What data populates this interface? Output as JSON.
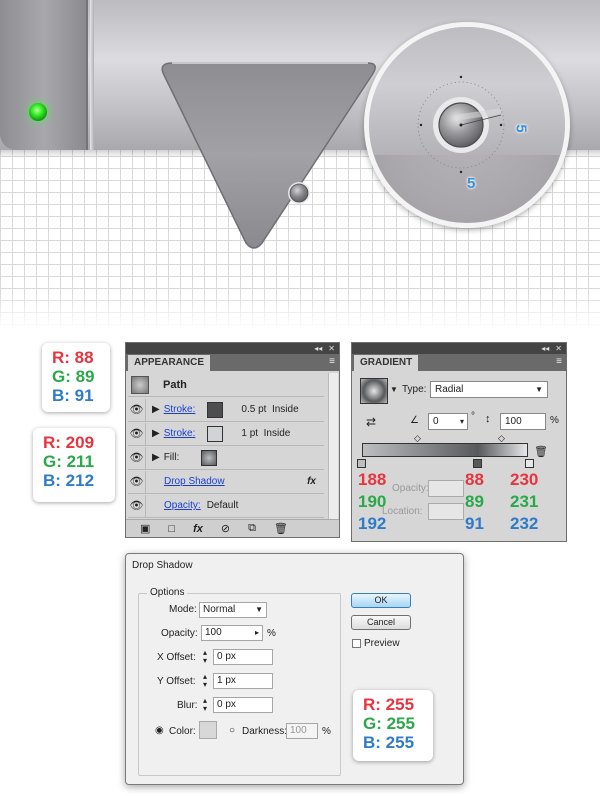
{
  "artwork": {
    "dim_right": "5",
    "dim_bottom": "5"
  },
  "swatches_left": [
    {
      "r": "R: 88",
      "g": "G: 89",
      "b": "B: 91"
    },
    {
      "r": "R: 209",
      "g": "G: 211",
      "b": "B: 212"
    }
  ],
  "appearance": {
    "tab": "APPEARANCE",
    "path_label": "Path",
    "rows": [
      {
        "label": "Stroke:",
        "value": "0.5 pt  Inside",
        "swatch_color": "#4e4e50"
      },
      {
        "label": "Stroke:",
        "value": "1 pt  Inside",
        "swatch_color": "#d1d3d4"
      },
      {
        "label": "Fill:",
        "value": ""
      },
      {
        "label": "Drop Shadow",
        "value": "fx"
      },
      {
        "label": "Opacity:",
        "value": "Default"
      }
    ],
    "bottom_icons": [
      "new-item-icon",
      "clear-icon",
      "fx-icon",
      "no-entry-icon",
      "duplicate-icon",
      "trash-icon"
    ]
  },
  "gradient": {
    "tab": "GRADIENT",
    "type_label": "Type:",
    "type_value": "Radial",
    "angle_value": "0",
    "aspect_value": "100",
    "percent": "%",
    "degree": "°",
    "opacity_label": "Opacity:",
    "location_label": "Location:",
    "stops": [
      {
        "r": "188",
        "g": "190",
        "b": "192"
      },
      {
        "r": "88",
        "g": "89",
        "b": "91"
      },
      {
        "r": "230",
        "g": "231",
        "b": "232"
      }
    ]
  },
  "drop_shadow": {
    "title": "Drop Shadow",
    "options_label": "Options",
    "mode_label": "Mode:",
    "mode_value": "Normal",
    "opacity_label": "Opacity:",
    "opacity_value": "100",
    "opacity_unit": "%",
    "xoffset_label": "X Offset:",
    "xoffset_value": "0 px",
    "yoffset_label": "Y Offset:",
    "yoffset_value": "1 px",
    "blur_label": "Blur:",
    "blur_value": "0 px",
    "color_label": "Color:",
    "darkness_label": "Darkness:",
    "darkness_value": "100",
    "darkness_unit": "%",
    "ok_label": "OK",
    "cancel_label": "Cancel",
    "preview_label": "Preview",
    "swatch": {
      "r": "R: 255",
      "g": "G: 255",
      "b": "B: 255"
    }
  }
}
